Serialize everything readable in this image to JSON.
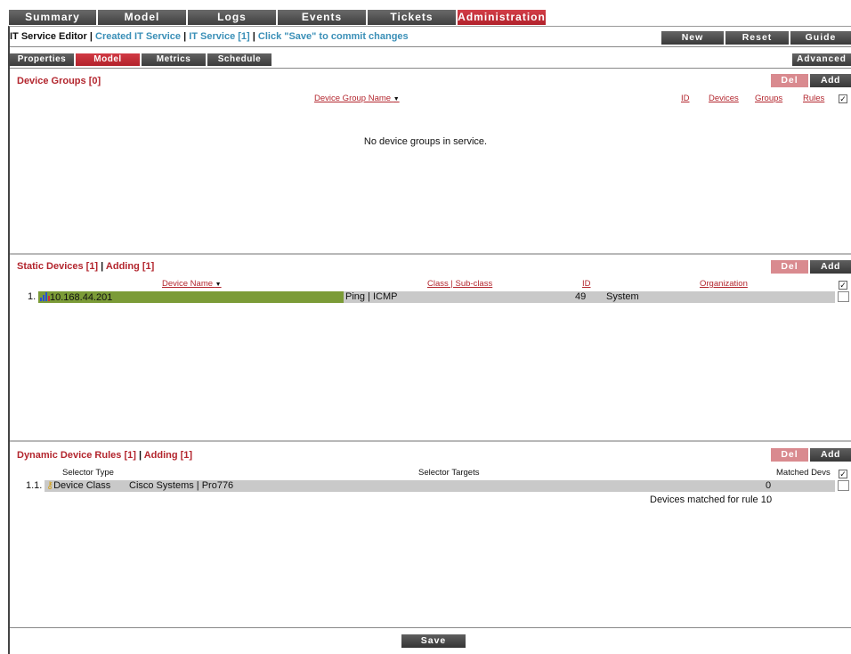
{
  "topnav": [
    "Summary",
    "Model",
    "Logs",
    "Events",
    "Tickets",
    "Administration"
  ],
  "editor": {
    "title": "IT Service Editor",
    "sep": "|",
    "created": "Created IT Service",
    "service": "IT Service [1]",
    "hint": "Click \"Save\" to commit changes",
    "new_label": "New",
    "reset_label": "Reset",
    "guide_label": "Guide"
  },
  "subtabs": [
    "Properties",
    "Model",
    "Metrics",
    "Schedule"
  ],
  "advanced_label": "Advanced",
  "buttons": {
    "del": "Del",
    "add": "Add",
    "save": "Save"
  },
  "device_groups": {
    "title": "Device Groups [0]",
    "columns": {
      "name": "Device Group Name",
      "id": "ID",
      "devices": "Devices",
      "groups": "Groups",
      "rules": "Rules"
    },
    "empty_text": "No device groups in service."
  },
  "static_devices": {
    "title": "Static Devices [1]",
    "bar": "|",
    "adding": "Adding [1]",
    "columns": {
      "name": "Device Name",
      "class": "Class | Sub-class",
      "id": "ID",
      "org": "Organization"
    },
    "rows": [
      {
        "index": "1.",
        "name": "10.168.44.201",
        "class": "Ping | ICMP",
        "id": "49",
        "org": "System"
      }
    ]
  },
  "dynamic_rules": {
    "title": "Dynamic Device Rules [1]",
    "bar": "|",
    "adding": "Adding [1]",
    "columns": {
      "selector_type": "Selector Type",
      "selector_targets": "Selector Targets",
      "matched": "Matched Devs"
    },
    "rows": [
      {
        "index": "1.1.",
        "type": "Device Class",
        "targets": "Cisco Systems | Pro776",
        "matched": "0"
      }
    ],
    "matched_label": "Devices matched for rule 1:",
    "matched_value": "0"
  },
  "colors": {
    "accent_red": "#b3262e",
    "link_blue": "#3a8fb7",
    "device_green": "#7b9b37",
    "row_grey": "#c9c9c9"
  }
}
